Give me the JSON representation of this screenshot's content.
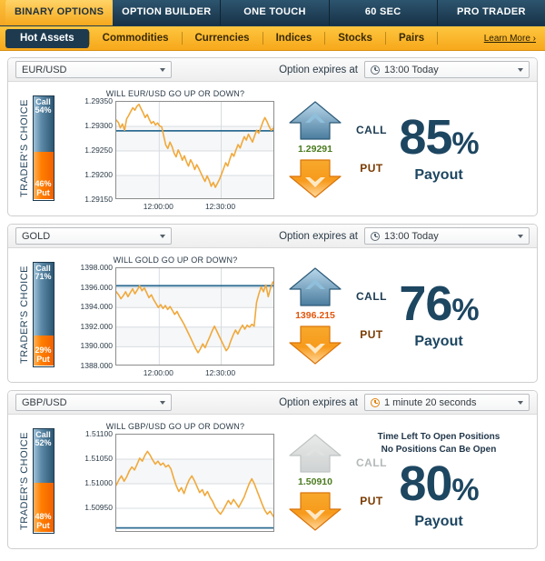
{
  "tabs": [
    {
      "label": "BINARY OPTIONS",
      "active": true
    },
    {
      "label": "OPTION BUILDER",
      "active": false
    },
    {
      "label": "ONE TOUCH",
      "active": false
    },
    {
      "label": "60 SEC",
      "active": false
    },
    {
      "label": "PRO TRADER",
      "active": false
    }
  ],
  "subnav": {
    "items": [
      {
        "label": "Hot Assets",
        "active": true
      },
      {
        "label": "Commodities",
        "active": false
      },
      {
        "label": "Currencies",
        "active": false
      },
      {
        "label": "Indices",
        "active": false
      },
      {
        "label": "Stocks",
        "active": false
      },
      {
        "label": "Pairs",
        "active": false
      }
    ],
    "learn_more": "Learn More ›"
  },
  "common": {
    "expires_label": "Option expires at",
    "traders_choice_label": "TRADER'S CHOICE",
    "payout_caption": "Payout",
    "call_label": "CALL",
    "put_label": "PUT"
  },
  "cards": [
    {
      "asset": "EUR/USD",
      "expiry": "13:00 Today",
      "expiry_urgent": false,
      "chart_title": "WILL EUR/USD GO UP OR DOWN?",
      "traders_choice": {
        "call_pct": "54%",
        "put_pct": "46%",
        "call_label": "Call",
        "put_label": "Put",
        "call_value": 54,
        "put_value": 46
      },
      "current_price": "1.29291",
      "price_color": "#4a7a1e",
      "payout": "85",
      "payout_symbol": "%",
      "disabled": false,
      "notice": []
    },
    {
      "asset": "GOLD",
      "expiry": "13:00 Today",
      "expiry_urgent": false,
      "chart_title": "WILL GOLD GO UP OR DOWN?",
      "traders_choice": {
        "call_pct": "71%",
        "put_pct": "29%",
        "call_label": "Call",
        "put_label": "Put",
        "call_value": 71,
        "put_value": 29
      },
      "current_price": "1396.215",
      "price_color": "#e2560d",
      "payout": "76",
      "payout_symbol": "%",
      "disabled": false,
      "notice": []
    },
    {
      "asset": "GBP/USD",
      "expiry": "1 minute 20 seconds",
      "expiry_urgent": true,
      "chart_title": "WILL GBP/USD GO UP OR DOWN?",
      "traders_choice": {
        "call_pct": "52%",
        "put_pct": "48%",
        "call_label": "Call",
        "put_label": "Put",
        "call_value": 52,
        "put_value": 48
      },
      "current_price": "1.50910",
      "price_color": "#4a7a1e",
      "payout": "80",
      "payout_symbol": "%",
      "disabled": true,
      "notice": [
        "Time Left To Open Positions",
        "No Positions Can Be Open"
      ]
    }
  ],
  "chart_data": [
    {
      "type": "line",
      "title": "WILL EUR/USD GO UP OR DOWN?",
      "asset": "EUR/USD",
      "xlabel": "",
      "ylabel": "",
      "ylim": [
        1.2915,
        1.2935
      ],
      "yticks": [
        "1.29350",
        "1.29300",
        "1.29250",
        "1.29200",
        "1.29150"
      ],
      "ytick_values": [
        1.2935,
        1.293,
        1.2925,
        1.292,
        1.2915
      ],
      "xticks": [
        "12:00:00",
        "12:30:00"
      ],
      "xtick_positions": [
        0.27,
        0.66
      ],
      "grid": true,
      "strike_line": 1.29291,
      "line_color": "#f0a93c",
      "strike_color": "#2f6d93",
      "values": [
        1.29313,
        1.29308,
        1.29297,
        1.29305,
        1.29292,
        1.29315,
        1.29322,
        1.2933,
        1.29338,
        1.29333,
        1.29341,
        1.29345,
        1.29336,
        1.29328,
        1.29318,
        1.29324,
        1.29314,
        1.29306,
        1.2931,
        1.29303,
        1.29307,
        1.29301,
        1.29299,
        1.2928,
        1.29262,
        1.29255,
        1.29268,
        1.29259,
        1.29246,
        1.29238,
        1.29252,
        1.29243,
        1.29231,
        1.2924,
        1.29228,
        1.29219,
        1.29232,
        1.29224,
        1.29212,
        1.29222,
        1.29214,
        1.29205,
        1.29196,
        1.29188,
        1.29199,
        1.2919,
        1.29178,
        1.29186,
        1.29176,
        1.29184,
        1.29192,
        1.29203,
        1.29214,
        1.29226,
        1.29219,
        1.29233,
        1.29245,
        1.29239,
        1.29252,
        1.29263,
        1.29256,
        1.29268,
        1.29279,
        1.29272,
        1.29284,
        1.29276,
        1.29268,
        1.29281,
        1.29292,
        1.29286,
        1.29297,
        1.29309,
        1.29318,
        1.2931,
        1.293,
        1.29292,
        1.29296,
        1.29291
      ]
    },
    {
      "type": "line",
      "title": "WILL GOLD GO UP OR DOWN?",
      "asset": "GOLD",
      "xlabel": "",
      "ylabel": "",
      "ylim": [
        1388.0,
        1398.0
      ],
      "yticks": [
        "1398.000",
        "1396.000",
        "1394.000",
        "1392.000",
        "1390.000",
        "1388.000"
      ],
      "ytick_values": [
        1398.0,
        1396.0,
        1394.0,
        1392.0,
        1390.0,
        1388.0
      ],
      "xticks": [
        "12:00:00",
        "12:30:00"
      ],
      "xtick_positions": [
        0.27,
        0.66
      ],
      "grid": true,
      "strike_line": 1396.215,
      "line_color": "#f0a93c",
      "strike_color": "#2f6d93",
      "values": [
        1395.6,
        1395.3,
        1394.9,
        1395.2,
        1395.6,
        1395.1,
        1395.5,
        1395.9,
        1395.4,
        1395.8,
        1396.2,
        1395.7,
        1396.0,
        1395.5,
        1395.0,
        1395.3,
        1394.8,
        1394.4,
        1394.0,
        1394.3,
        1393.9,
        1394.2,
        1393.8,
        1394.1,
        1393.7,
        1393.3,
        1393.6,
        1393.1,
        1392.7,
        1392.3,
        1391.8,
        1391.3,
        1390.8,
        1390.3,
        1389.8,
        1389.4,
        1389.8,
        1390.3,
        1389.9,
        1390.5,
        1391.0,
        1391.6,
        1392.1,
        1391.6,
        1391.1,
        1390.6,
        1390.1,
        1389.6,
        1389.9,
        1390.6,
        1391.2,
        1391.7,
        1391.3,
        1391.8,
        1392.2,
        1391.8,
        1392.2,
        1392.0,
        1392.3,
        1392.1,
        1394.5,
        1395.4,
        1396.1,
        1395.6,
        1396.3,
        1395.1,
        1396.0,
        1396.6,
        1396.2
      ]
    },
    {
      "type": "line",
      "title": "WILL GBP/USD GO UP OR DOWN?",
      "asset": "GBP/USD",
      "xlabel": "",
      "ylabel": "",
      "ylim": [
        1.509,
        1.511
      ],
      "yticks": [
        "1.51100",
        "1.51050",
        "1.51000",
        "1.50950"
      ],
      "ytick_values": [
        1.511,
        1.5105,
        1.51,
        1.5095
      ],
      "xticks": [],
      "xtick_positions": [],
      "grid": true,
      "strike_line": 1.5091,
      "line_color": "#f0a93c",
      "strike_color": "#2f6d93",
      "values": [
        1.50997,
        1.51008,
        1.51016,
        1.51005,
        1.51014,
        1.51026,
        1.51034,
        1.51028,
        1.5104,
        1.51052,
        1.51046,
        1.51058,
        1.51066,
        1.51058,
        1.51048,
        1.5104,
        1.51046,
        1.51038,
        1.51042,
        1.51034,
        1.51038,
        1.5103,
        1.51012,
        1.50996,
        1.50984,
        1.50992,
        1.5098,
        1.50996,
        1.51008,
        1.51016,
        1.51006,
        1.50994,
        1.50982,
        1.50988,
        1.50976,
        1.50984,
        1.50972,
        1.50964,
        1.50952,
        1.50944,
        1.50938,
        1.50946,
        1.50956,
        1.50966,
        1.50958,
        1.50968,
        1.5096,
        1.50952,
        1.50962,
        1.50972,
        1.50986,
        1.51,
        1.5101,
        1.51,
        1.50986,
        1.50972,
        1.50958,
        1.50946,
        1.50938,
        1.50944,
        1.50936,
        1.50928
      ]
    }
  ]
}
